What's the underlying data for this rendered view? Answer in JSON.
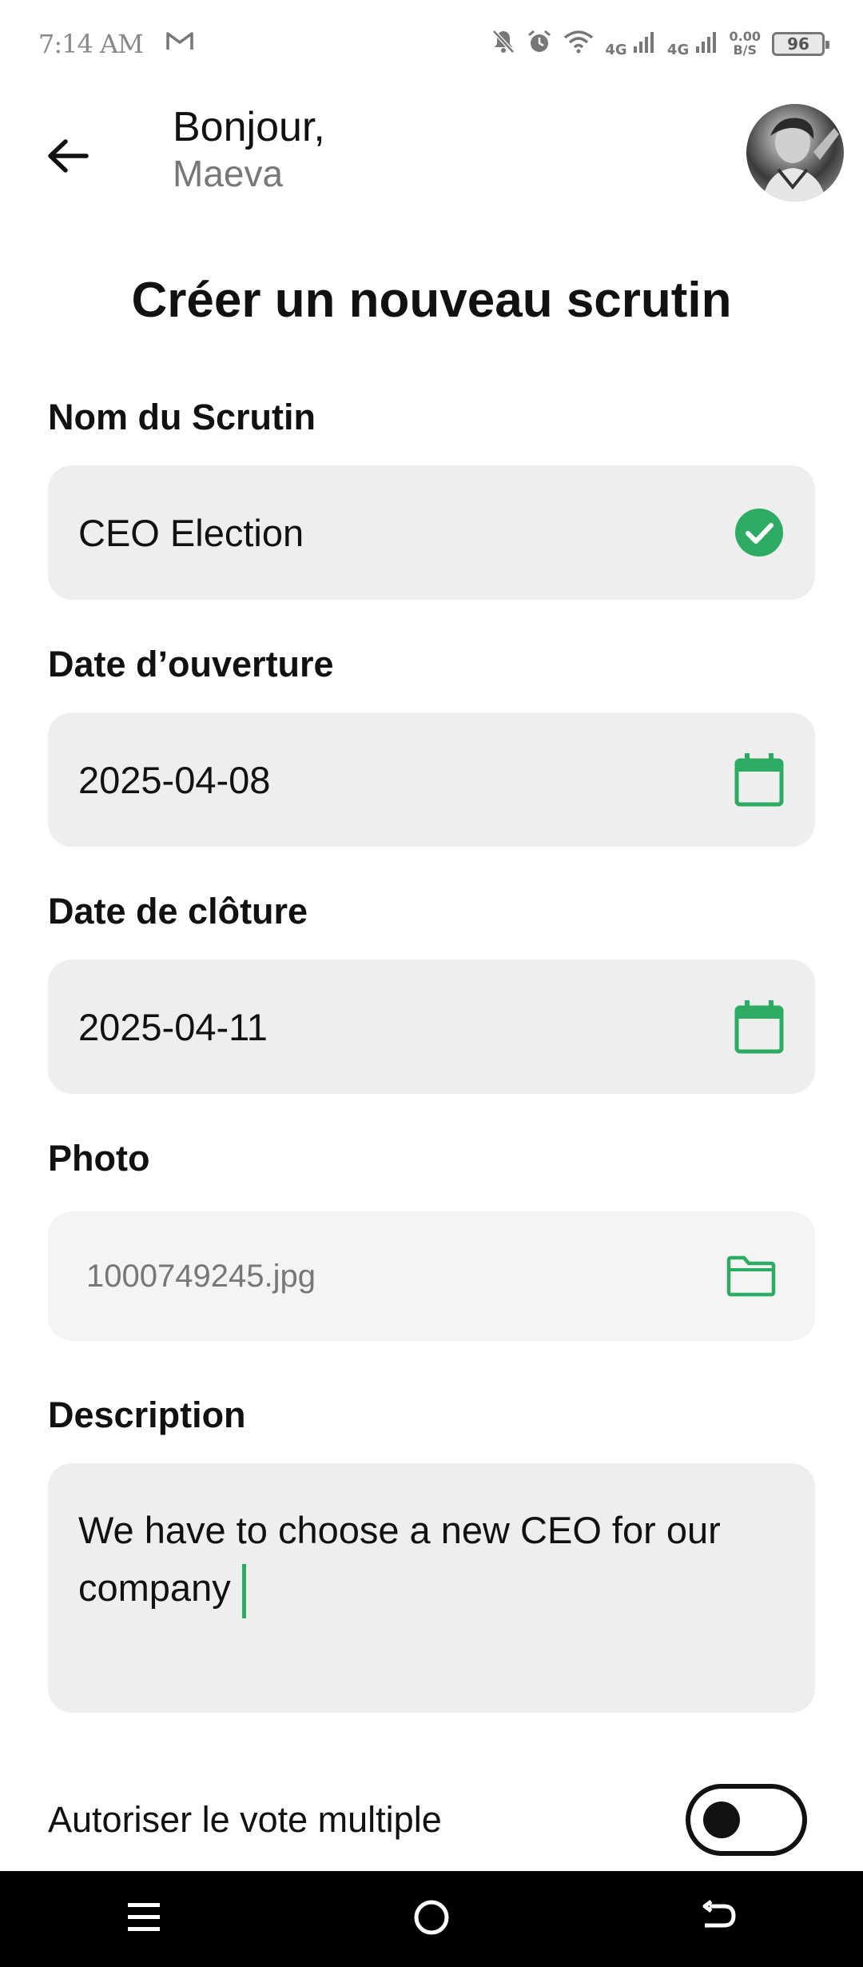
{
  "status_bar": {
    "time": "7:14 AM",
    "network_1": "4G",
    "network_2": "4G",
    "speed_value": "0.00",
    "speed_unit": "B/S",
    "battery": "96"
  },
  "header": {
    "greeting": "Bonjour,",
    "user_name": "Maeva"
  },
  "page_title": "Créer un nouveau scrutin",
  "form": {
    "name_label": "Nom du Scrutin",
    "name_value": "CEO Election",
    "open_date_label": "Date d’ouverture",
    "open_date_value": "2025-04-08",
    "close_date_label": "Date de clôture",
    "close_date_value": "2025-04-11",
    "photo_label": "Photo",
    "photo_value": "1000749245.jpg",
    "description_label": "Description",
    "description_value": "We have to choose a new CEO for our company",
    "multi_vote_label": "Autoriser le vote multiple",
    "multi_vote_enabled": false
  },
  "colors": {
    "accent": "#2eab63",
    "field_bg": "#eeeeee"
  },
  "icons": {
    "back": "arrow-left-icon",
    "valid": "check-circle-icon",
    "calendar": "calendar-icon",
    "folder": "folder-icon"
  }
}
